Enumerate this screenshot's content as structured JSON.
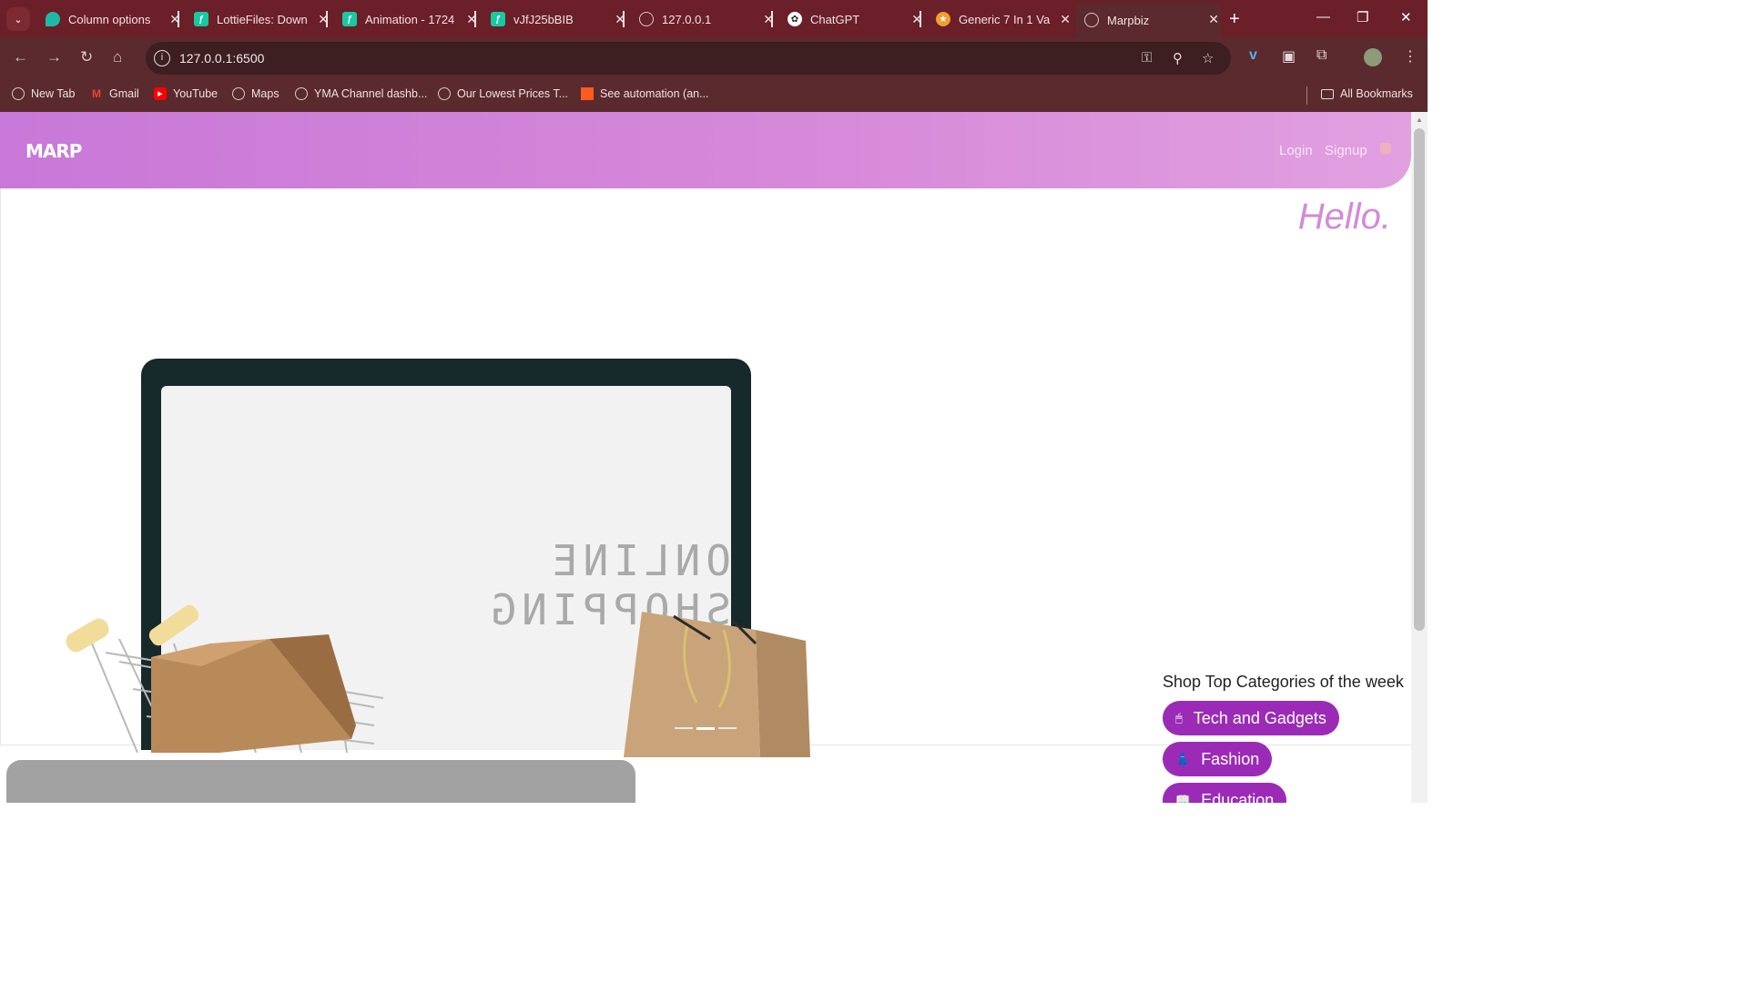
{
  "browser": {
    "tabs": [
      {
        "title": "Column options",
        "favicon": "column-options-icon"
      },
      {
        "title": "LottieFiles: Down",
        "favicon": "lottiefiles-icon"
      },
      {
        "title": "Animation - 1724",
        "favicon": "lottiefiles-icon"
      },
      {
        "title": "vJfJ25bBIB",
        "favicon": "lottiefiles-icon"
      },
      {
        "title": "127.0.0.1",
        "favicon": "globe-icon"
      },
      {
        "title": "ChatGPT",
        "favicon": "chatgpt-icon"
      },
      {
        "title": "Generic 7 In 1 Va",
        "favicon": "star-icon"
      },
      {
        "title": "Marpbiz",
        "favicon": "globe-icon",
        "active": true
      }
    ],
    "url": "127.0.0.1:6500",
    "bookmarks": [
      {
        "label": "New Tab",
        "icon": "globe-icon"
      },
      {
        "label": "Gmail",
        "icon": "gmail-icon"
      },
      {
        "label": "YouTube",
        "icon": "youtube-icon"
      },
      {
        "label": "Maps",
        "icon": "globe-icon"
      },
      {
        "label": "YMA Channel dashb...",
        "icon": "globe-icon"
      },
      {
        "label": "Our Lowest Prices T...",
        "icon": "globe-icon"
      },
      {
        "label": "See automation (an...",
        "icon": "automation-icon"
      }
    ],
    "all_bookmarks": "All Bookmarks",
    "colors": {
      "frame": "#6b1f28",
      "toolbar": "#5a2a2e",
      "omnibox": "#3d1e21"
    }
  },
  "site": {
    "logo": "MARP",
    "nav": {
      "login": "Login",
      "signup": "Signup"
    },
    "hero": {
      "greeting": "Hello.",
      "image_text": "ONLINE SHOPPING",
      "slides": 3,
      "active_slide": 2
    },
    "categories": {
      "title": "Shop Top Categories of the week",
      "items": [
        {
          "label": "Tech and Gadgets",
          "icon": "mouse-icon"
        },
        {
          "label": "Fashion",
          "icon": "dress-icon"
        },
        {
          "label": "Education",
          "icon": "book-icon"
        }
      ]
    },
    "colors": {
      "header_start": "#c878d8",
      "header_end": "#e1a0e0",
      "accent": "#9b2bb6",
      "greeting": "#d48ad8"
    }
  }
}
